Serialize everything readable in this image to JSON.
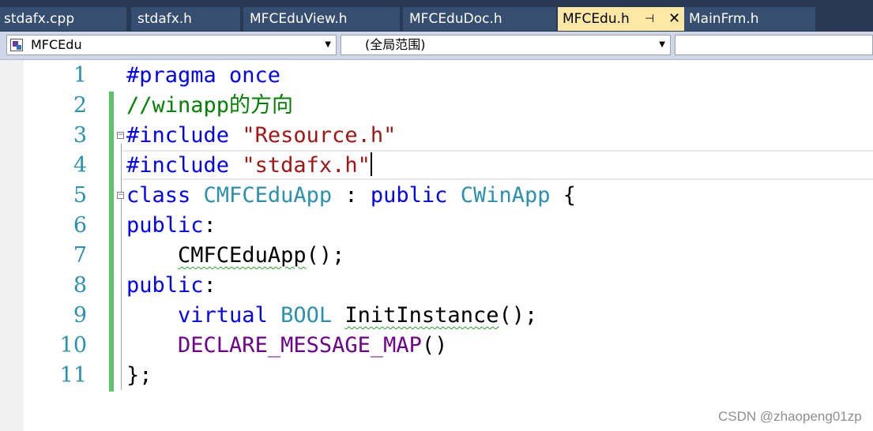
{
  "tabs": [
    {
      "label": "stdafx.cpp",
      "active": false
    },
    {
      "label": "stdafx.h",
      "active": false
    },
    {
      "label": "MFCEduView.h",
      "active": false
    },
    {
      "label": "MFCEduDoc.h",
      "active": false
    },
    {
      "label": "MFCEdu.h",
      "active": true
    },
    {
      "label": "MainFrm.h",
      "active": false
    }
  ],
  "navbar": {
    "class_combo": "MFCEdu",
    "member_combo": "(全局范围)"
  },
  "editor": {
    "line_numbers": [
      "1",
      "2",
      "3",
      "4",
      "5",
      "6",
      "7",
      "8",
      "9",
      "10",
      "11"
    ],
    "lines": {
      "l1": {
        "kw": "#pragma once"
      },
      "l2": {
        "comment": "//winapp的方向"
      },
      "l3": {
        "kw": "#include",
        "sp": " ",
        "str": "\"Resource.h\""
      },
      "l4": {
        "kw": "#include",
        "sp": " ",
        "str": "\"stdafx.h\""
      },
      "l5": {
        "kw1": "class",
        "t1": "CMFCEduApp",
        "p1": " : ",
        "kw2": "public",
        "t2": "CWinApp",
        "p2": " {"
      },
      "l6": {
        "kw": "public",
        "p": ":"
      },
      "l7": {
        "indent": "    ",
        "fn": "CMFCEduApp",
        "p": "();"
      },
      "l8": {
        "kw": "public",
        "p": ":"
      },
      "l9": {
        "indent": "    ",
        "kw": "virtual",
        "t": "BOOL",
        "fn": "InitInstance",
        "p": "();"
      },
      "l10": {
        "indent": "    ",
        "macro": "DECLARE_MESSAGE_MAP",
        "p": "()"
      },
      "l11": {
        "p": "};"
      }
    }
  },
  "colors": {
    "keyword": "#0000ff",
    "comment": "#008000",
    "string": "#a31515",
    "type": "#2b91af",
    "macro": "#6f008a",
    "active_tab": "#ffe8a6",
    "tab_strip": "#293955"
  },
  "icons": {
    "pin": "pin-icon",
    "close": "close-icon",
    "class": "class-icon",
    "dropdown": "chevron-down-icon"
  },
  "watermark": "CSDN @zhaopeng01zp"
}
